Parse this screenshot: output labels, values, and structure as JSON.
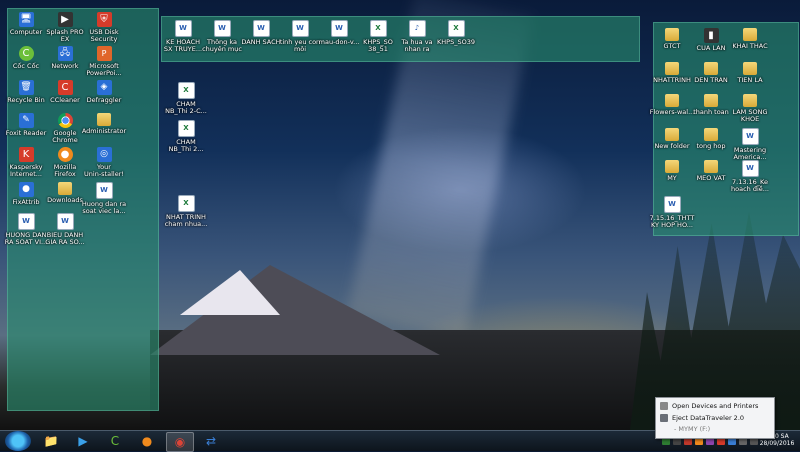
{
  "left_icons": [
    {
      "label": "Computer",
      "kind": "app",
      "glyph": "🖥"
    },
    {
      "label": "Splash PRO\nEX",
      "kind": "dark",
      "glyph": "▶"
    },
    {
      "label": "USB Disk\nSecurity",
      "kind": "red",
      "glyph": "⛨"
    },
    {
      "label": "Cốc Cốc",
      "kind": "green",
      "glyph": "C"
    },
    {
      "label": "Network",
      "kind": "app",
      "glyph": "🖧"
    },
    {
      "label": "Microsoft\nPowerPoi...",
      "kind": "ppt",
      "glyph": "P"
    },
    {
      "label": "Recycle Bin",
      "kind": "app",
      "glyph": "🗑"
    },
    {
      "label": "CCleaner",
      "kind": "red",
      "glyph": "C"
    },
    {
      "label": "Defraggler",
      "kind": "app",
      "glyph": "◈"
    },
    {
      "label": "Foxit Reader",
      "kind": "app",
      "glyph": "✎"
    },
    {
      "label": "Google\nChrome",
      "kind": "chrome",
      "glyph": ""
    },
    {
      "label": "Administrator",
      "kind": "folder",
      "glyph": ""
    },
    {
      "label": "Kaspersky\nInternet...",
      "kind": "red",
      "glyph": "K"
    },
    {
      "label": "Mozilla\nFirefox",
      "kind": "orange",
      "glyph": "●"
    },
    {
      "label": "Your\nUnin-staller!",
      "kind": "app",
      "glyph": "◎"
    },
    {
      "label": "FixAttrib",
      "kind": "app",
      "glyph": "●"
    },
    {
      "label": "Downloads",
      "kind": "folder",
      "glyph": ""
    },
    {
      "label": "Huong dan ra\nsoat viec la...",
      "kind": "doc",
      "glyph": "W"
    },
    {
      "label": "HUONG DAN\nRA SOAT VI...",
      "kind": "doc",
      "glyph": "W"
    },
    {
      "label": "BIEU DANH\nGIA RA SO...",
      "kind": "doc",
      "glyph": "W"
    }
  ],
  "top_icons": [
    {
      "label": "KE HOACH\nSX TRUYE...",
      "kind": "doc",
      "glyph": "W"
    },
    {
      "label": "Thông ka\nchuyên mục",
      "kind": "doc",
      "glyph": "W"
    },
    {
      "label": "DANH SACH",
      "kind": "doc",
      "glyph": "W"
    },
    {
      "label": "tinh yeu con\nmôi",
      "kind": "doc",
      "glyph": "W"
    },
    {
      "label": "mau-don-v...",
      "kind": "doc",
      "glyph": "W"
    },
    {
      "label": "KHPS_SO\n38_51",
      "kind": "xls",
      "glyph": "X"
    },
    {
      "label": "Ta hua va\nnhan ra",
      "kind": "doc",
      "glyph": "♪"
    },
    {
      "label": "KHPS_SO39",
      "kind": "xls",
      "glyph": "X"
    }
  ],
  "middle_icons": [
    {
      "label": "CHAM\nNB_Thi 2-C...",
      "kind": "xls",
      "glyph": "X"
    },
    {
      "label": "CHAM\nNB_Thi 2...",
      "kind": "xls",
      "glyph": "X"
    },
    {
      "label": "NHAT TRINH\ncham nhua...",
      "kind": "xls",
      "glyph": "X"
    }
  ],
  "right_icons": [
    {
      "label": "GTCT",
      "kind": "folder",
      "glyph": ""
    },
    {
      "label": "CUA LAN",
      "kind": "dark",
      "glyph": "▮"
    },
    {
      "label": "KHAI THAC",
      "kind": "folder",
      "glyph": ""
    },
    {
      "label": "NHATTRINH",
      "kind": "folder",
      "glyph": ""
    },
    {
      "label": "DEN TRAN",
      "kind": "folder",
      "glyph": ""
    },
    {
      "label": "TIEN LA",
      "kind": "folder",
      "glyph": ""
    },
    {
      "label": "Flowers-wal...",
      "kind": "folder",
      "glyph": ""
    },
    {
      "label": "thanh toan",
      "kind": "folder",
      "glyph": ""
    },
    {
      "label": "LAM SONG\nKHOE",
      "kind": "folder",
      "glyph": ""
    },
    {
      "label": "New folder",
      "kind": "folder",
      "glyph": ""
    },
    {
      "label": "tong hop",
      "kind": "folder",
      "glyph": ""
    },
    {
      "label": "Mastering\nAmerica...",
      "kind": "doc",
      "glyph": "W"
    },
    {
      "label": "MY",
      "kind": "folder",
      "glyph": ""
    },
    {
      "label": "MEO VAT",
      "kind": "folder",
      "glyph": ""
    },
    {
      "label": "7.13.16_Ke\nhoach điề...",
      "kind": "doc",
      "glyph": "W"
    },
    {
      "label": "7.15.16_THTT\nKY HOP HO...",
      "kind": "doc",
      "glyph": "W"
    }
  ],
  "taskbar": {
    "apps": [
      {
        "name": "explorer",
        "glyph": "📁",
        "color": "#f2c94c"
      },
      {
        "name": "media",
        "glyph": "▶",
        "color": "#3aa0e8"
      },
      {
        "name": "coccoc",
        "glyph": "C",
        "color": "#6cbf3a"
      },
      {
        "name": "firefox",
        "glyph": "●",
        "color": "#f08a1d"
      },
      {
        "name": "chrome",
        "glyph": "◉",
        "color": "#db4437"
      },
      {
        "name": "teamviewer",
        "glyph": "⇄",
        "color": "#3a7fd6"
      }
    ],
    "active_app": "chrome",
    "clock_time": "8:40 SA",
    "clock_date": "28/09/2016"
  },
  "popup": {
    "item1": "Open Devices and Printers",
    "item2": "Eject DataTraveler 2.0",
    "item3": "- MYMY (F:)"
  }
}
